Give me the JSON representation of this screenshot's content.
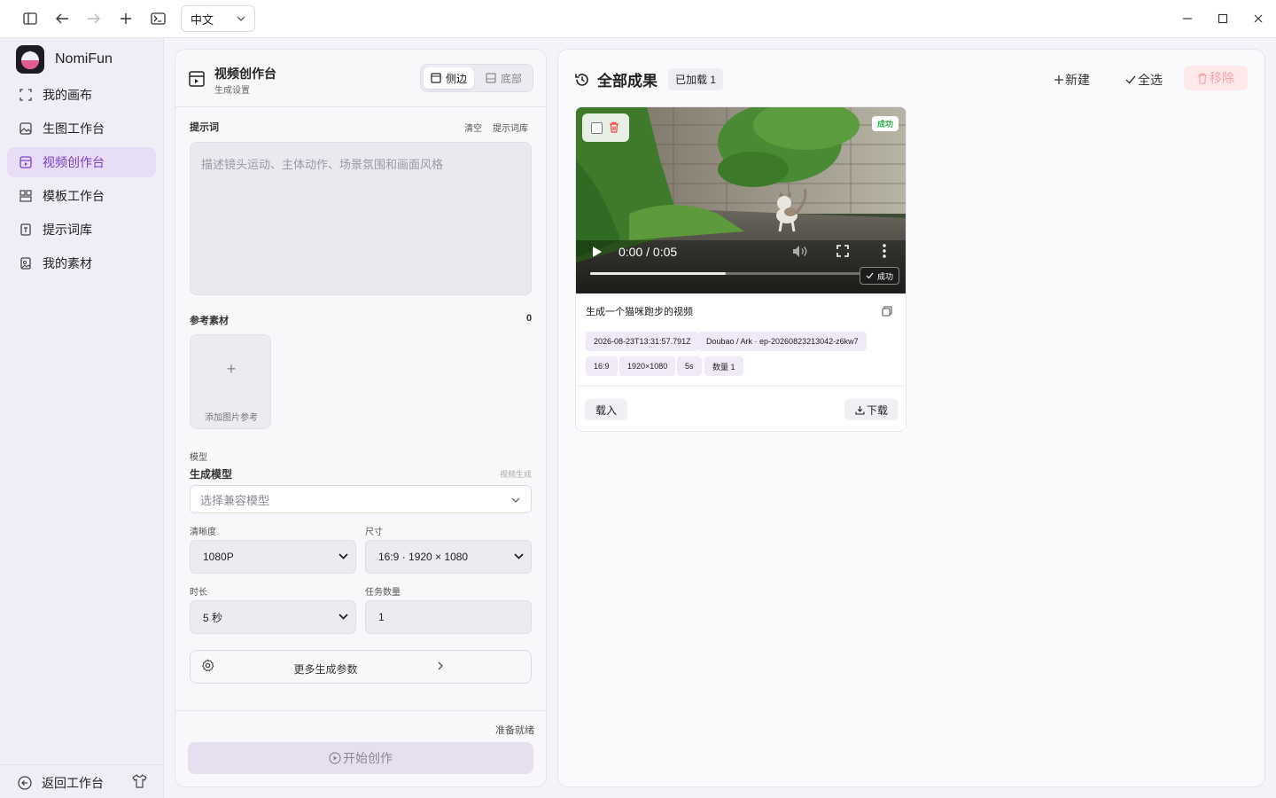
{
  "titlebar": {
    "icons": [
      "sidebar-toggle-icon",
      "back-arrow-icon",
      "forward-arrow-icon",
      "plus-icon",
      "terminal-icon"
    ],
    "language": "中文",
    "window_controls": [
      "minimize-icon",
      "maximize-icon",
      "close-icon"
    ]
  },
  "sidebar": {
    "brand": "NomiFun",
    "items": [
      {
        "label": "我的画布",
        "icon": "canvas-icon"
      },
      {
        "label": "生图工作台",
        "icon": "image-icon"
      },
      {
        "label": "视频创作台",
        "icon": "video-icon",
        "active": true
      },
      {
        "label": "模板工作台",
        "icon": "template-icon"
      },
      {
        "label": "提示词库",
        "icon": "prompt-icon"
      },
      {
        "label": "我的素材",
        "icon": "assets-icon"
      }
    ],
    "back_label": "返回工作台"
  },
  "settings": {
    "title": "视频创作台",
    "subtitle": "生成设置",
    "layout_side": "侧边",
    "layout_bottom": "底部",
    "prompt_label": "提示词",
    "clear_label": "清空",
    "library_label": "提示词库",
    "prompt_placeholder": "描述镜头运动、主体动作、场景氛围和画面风格",
    "ref_label": "参考素材",
    "ref_count": "0",
    "add_ref_label": "添加图片参考",
    "model_section": "模型",
    "model_label": "生成模型",
    "model_hint": "视频生成",
    "model_placeholder": "选择兼容模型",
    "res_label": "清晰度",
    "res_value": "1080P",
    "size_label": "尺寸",
    "size_value": "16:9 · 1920 × 1080",
    "dur_label": "时长",
    "dur_value": "5 秒",
    "count_label": "任务数量",
    "count_value": "1",
    "more_label": "更多生成参数",
    "ready_label": "准备就绪",
    "start_label": "开始创作"
  },
  "results": {
    "title": "全部成果",
    "loaded": "已加载 1",
    "new_label": "新建",
    "select_all_label": "全选",
    "remove_label": "移除",
    "card": {
      "status": "成功",
      "time": "0:00 / 0:05",
      "progress": 0.5,
      "caption": "生成一个猫咪跑步的视频",
      "tags_row1": [
        "2026-08-23T13:31:57.791Z",
        "Doubao / Ark · ep-20260823213042-z6kw7"
      ],
      "tags_row2": [
        "16:9",
        "1920×1080",
        "5s",
        "数量 1"
      ],
      "load_label": "载入",
      "download_label": "下载"
    }
  },
  "colors": {
    "accent": "#7a3fc7",
    "active_bg": "#e7ddf6",
    "danger": "#ee4444",
    "success": "#2bb24c"
  }
}
